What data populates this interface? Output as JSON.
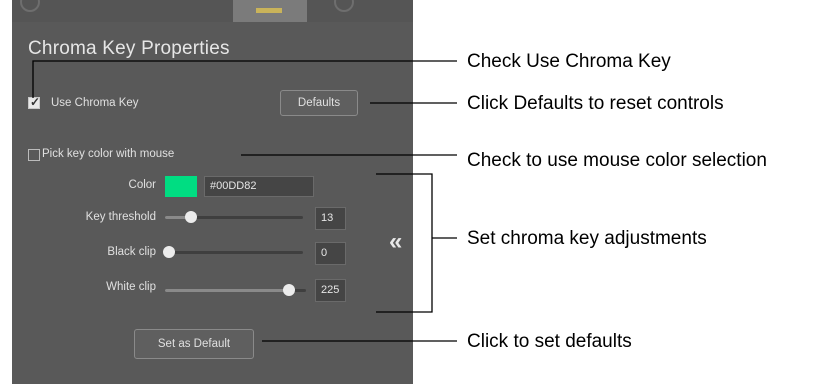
{
  "panel": {
    "title": "Chroma Key Properties",
    "use_chroma_key": {
      "label": "Use Chroma Key",
      "checked": true
    },
    "defaults_button": "Defaults",
    "pick_key_color": {
      "label": "Pick key color with mouse",
      "checked": false
    },
    "color": {
      "label": "Color",
      "hex": "#00DD82",
      "swatch_color": "#00dd82"
    },
    "sliders": [
      {
        "label": "Key threshold",
        "value": "13",
        "fraction": 0.19
      },
      {
        "label": "Black clip",
        "value": "0",
        "fraction": 0.0
      },
      {
        "label": "White clip",
        "value": "225",
        "fraction": 0.88
      }
    ],
    "set_default_button": "Set as Default",
    "collapse_icon": "«"
  },
  "annotations": {
    "use_chroma_key": "Check Use Chroma Key",
    "defaults": "Click Defaults to reset controls",
    "mouse_selection": "Check to use mouse color selection",
    "adjustments": "Set chroma key adjustments",
    "set_defaults": "Click to set defaults"
  }
}
